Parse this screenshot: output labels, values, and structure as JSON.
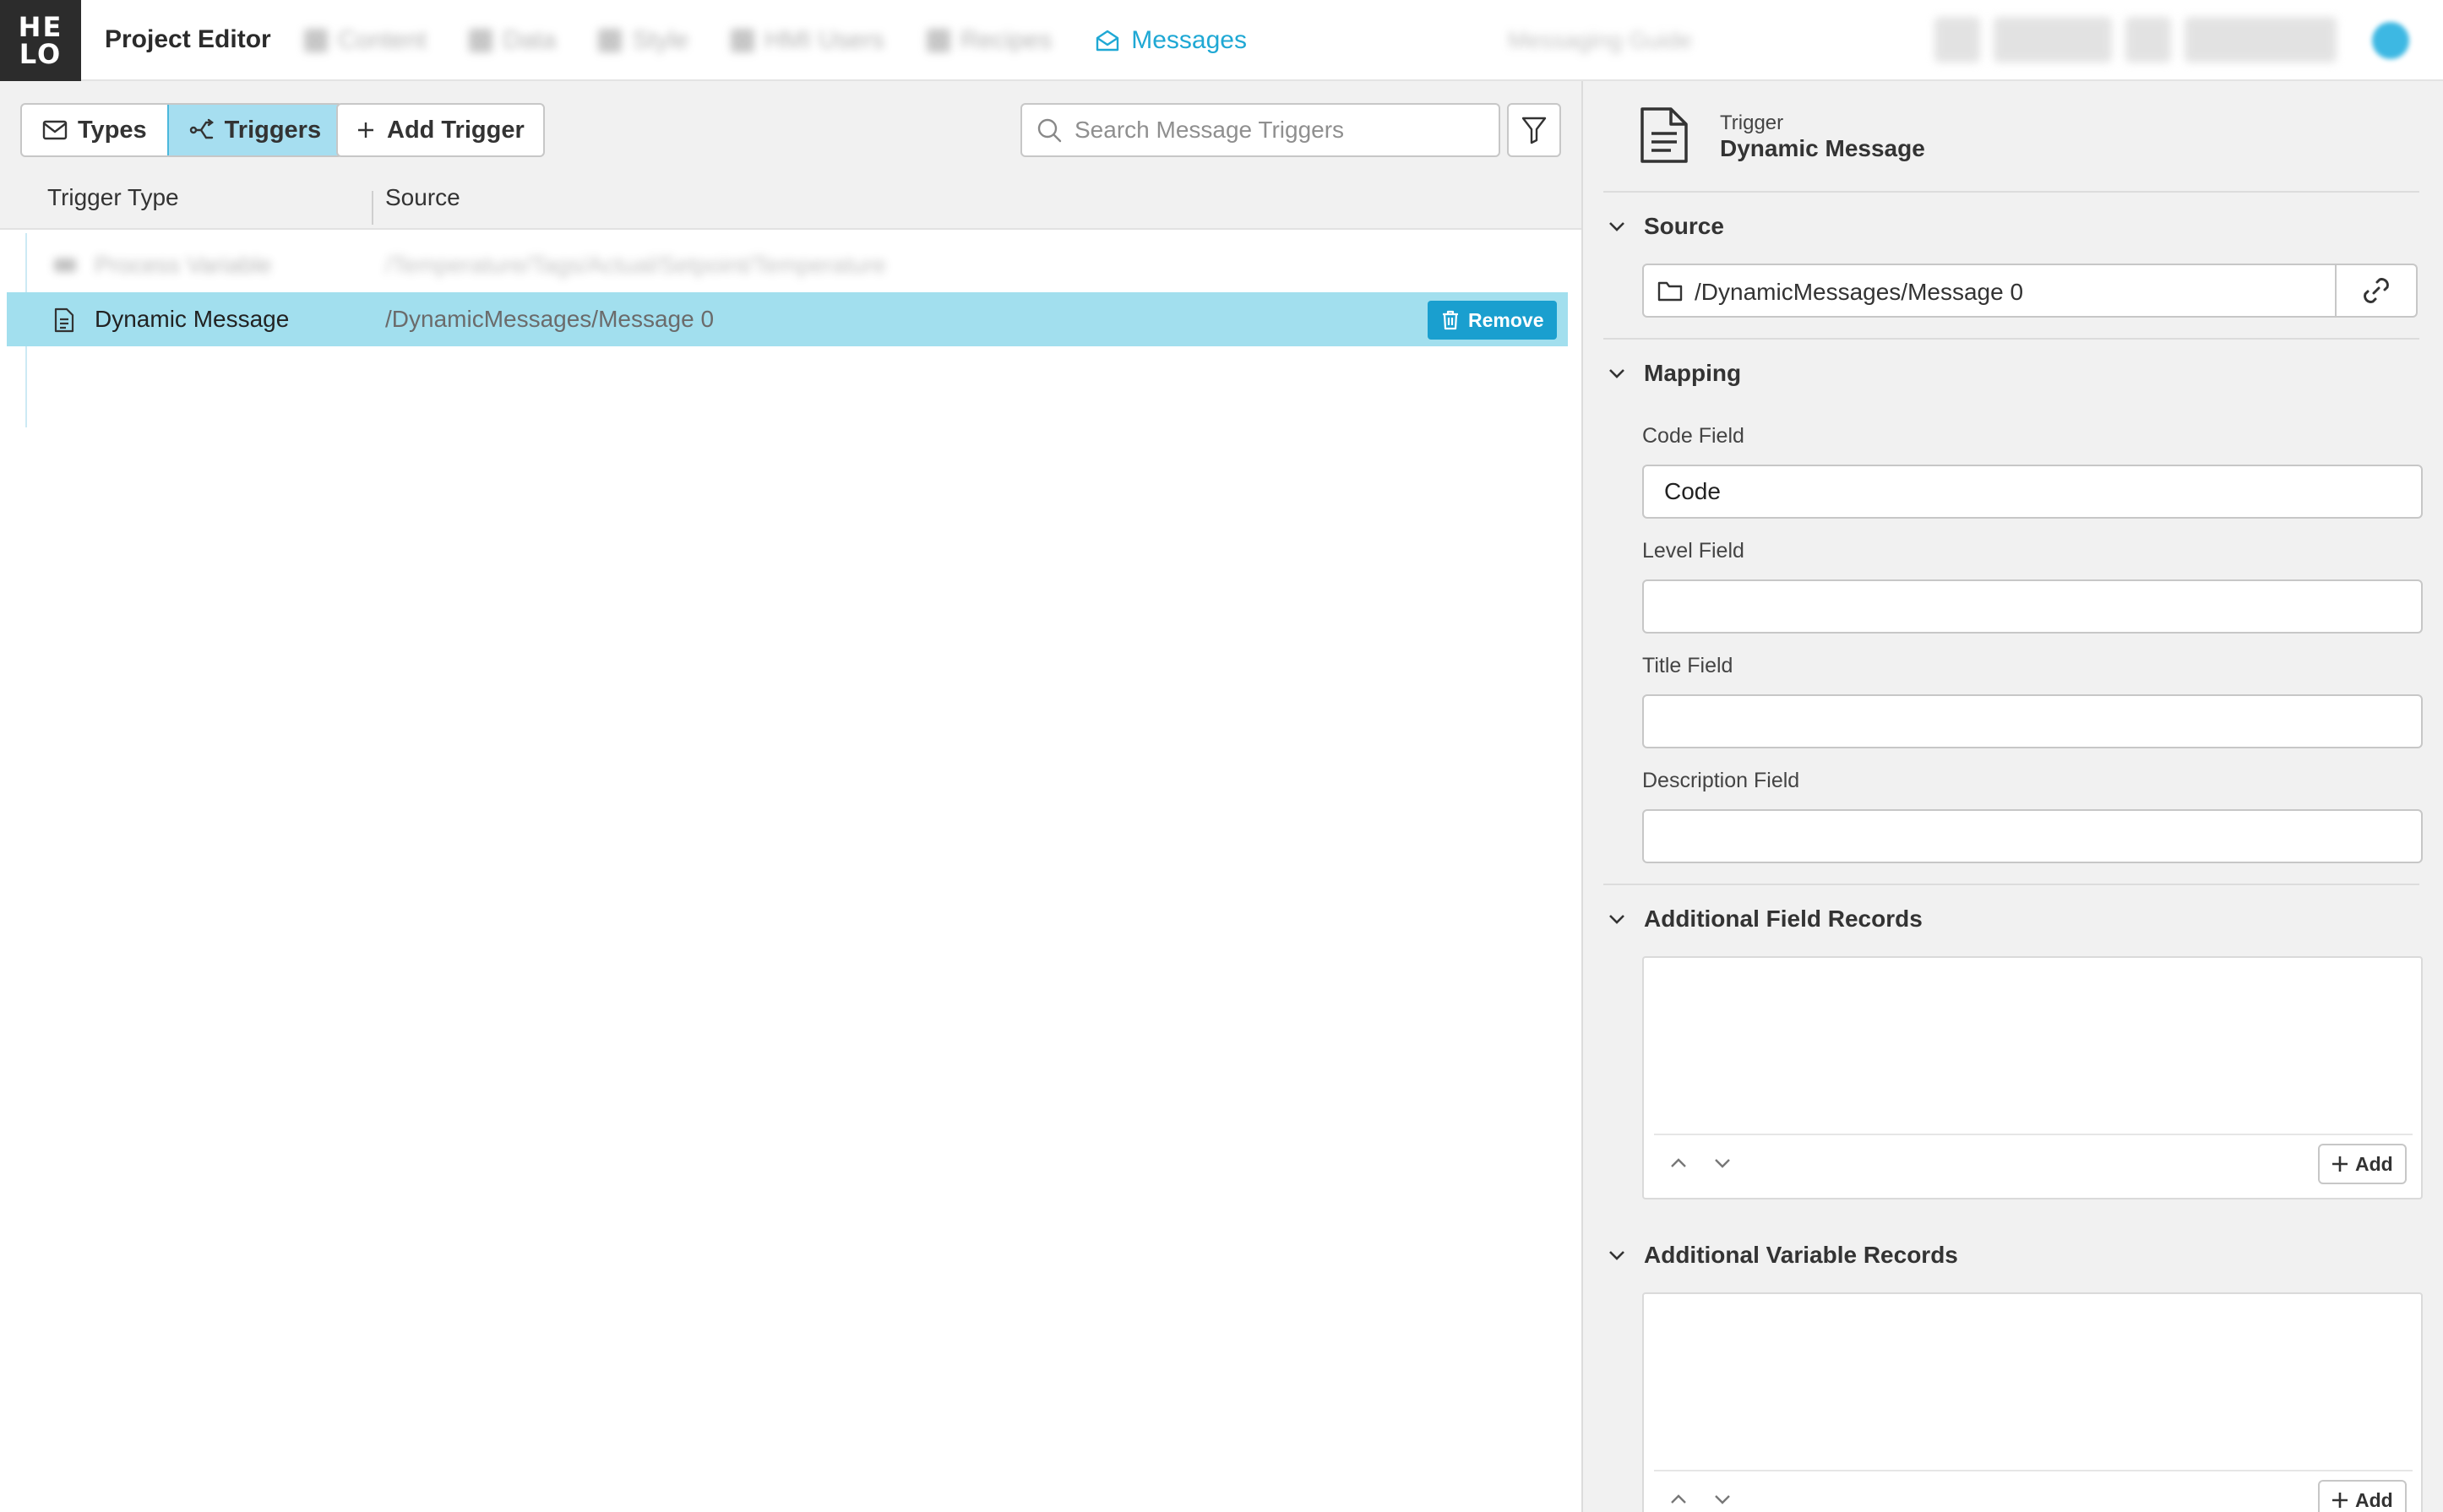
{
  "header": {
    "logo_line1": "HE",
    "logo_line2": "LO",
    "app_title": "Project Editor",
    "nav": [
      {
        "label": "Content",
        "icon": "content-icon"
      },
      {
        "label": "Data",
        "icon": "data-icon"
      },
      {
        "label": "Style",
        "icon": "style-icon"
      },
      {
        "label": "HMI Users",
        "icon": "users-icon"
      },
      {
        "label": "Recipes",
        "icon": "recipes-icon"
      },
      {
        "label": "Messages",
        "icon": "envelope-open-icon"
      }
    ],
    "active_nav": "Messages",
    "guide_label": "Messaging Guide"
  },
  "toolbar": {
    "types_label": "Types",
    "triggers_label": "Triggers",
    "add_trigger_label": "Add Trigger",
    "search_placeholder": "Search Message Triggers"
  },
  "table": {
    "columns": [
      "Trigger Type",
      "Source"
    ],
    "rows": [
      {
        "type": "Process Variable",
        "source": "/Temperature/Tags/Actual/Setpoint/Temperature",
        "blurred": true
      },
      {
        "type": "Dynamic Message",
        "source": "/DynamicMessages/Message 0",
        "selected": true
      }
    ],
    "remove_label": "Remove"
  },
  "panel": {
    "subtitle": "Trigger",
    "title": "Dynamic Message",
    "source_section": "Source",
    "source_path": "/DynamicMessages/Message 0",
    "mapping_section": "Mapping",
    "code_field_label": "Code Field",
    "code_field_value": "Code",
    "level_field_label": "Level Field",
    "level_field_value": "",
    "title_field_label": "Title Field",
    "title_field_value": "",
    "description_field_label": "Description Field",
    "description_field_value": "",
    "additional_field_records_section": "Additional Field Records",
    "additional_variable_records_section": "Additional Variable Records",
    "add_label": "Add"
  },
  "colors": {
    "accent": "#1fa8d4",
    "selected_row": "#a2dfee",
    "segment_active": "#a6def0",
    "remove_button": "#1a9fcf"
  }
}
